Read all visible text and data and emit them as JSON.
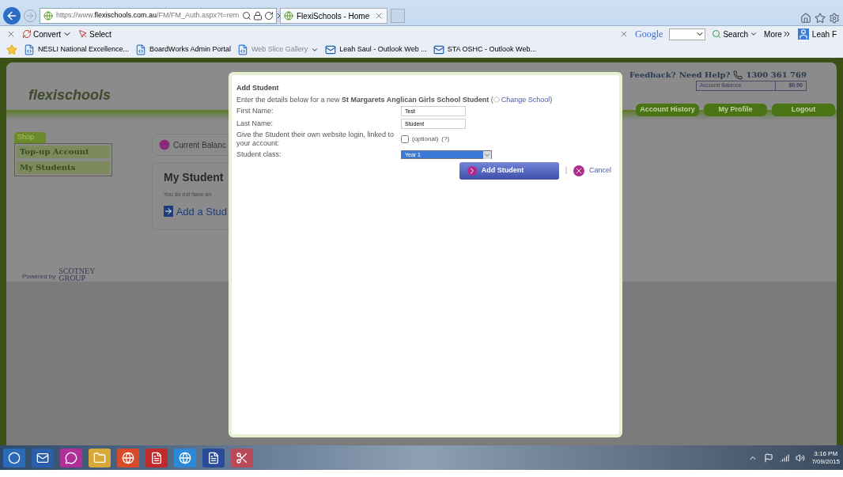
{
  "browser": {
    "address": {
      "prefix": "https://www.",
      "host": "flexischools.com.au",
      "path": "/FM/FM_Auth.aspx?t=rem"
    },
    "tab": {
      "title": "FlexiSchools - Home"
    },
    "toolbar": [
      "Convert",
      "Select"
    ],
    "search": {
      "brand": "Google",
      "button": "Search",
      "more": "More",
      "user": "Leah F"
    },
    "favorites": [
      {
        "label": "NESLI National Excellence...",
        "kind": "page",
        "dim": false
      },
      {
        "label": "BoardWorks Admin Portal",
        "kind": "page",
        "dim": false
      },
      {
        "label": "Web Slice Gallery",
        "kind": "page",
        "dim": true
      },
      {
        "label": "Leah Saul - Outlook Web ...",
        "kind": "outlook",
        "dim": false
      },
      {
        "label": "STA OSHC - Outlook Web...",
        "kind": "outlook",
        "dim": false
      }
    ]
  },
  "page": {
    "logo": "flexischools",
    "help": {
      "feedback": "Feedback?",
      "need_help": "Need Help?",
      "phone": "1300 361 769",
      "balance_label": "Account Balance",
      "balance": "$0.00"
    },
    "nav": [
      "Account History",
      "My Profile",
      "Logout"
    ],
    "sidebar": {
      "tab": "Shop",
      "items": [
        "Top-up Account",
        "My Students"
      ]
    },
    "current_balance": "Current Balanc",
    "students_title": "My Student",
    "students_note": "You do not have an",
    "add_link": "Add a Stud",
    "powered_by": "Powered by",
    "powered_brand": [
      "SCOTNEY",
      "GROUP"
    ]
  },
  "modal": {
    "title": "Add Student",
    "intro": "Enter the details below for a new **St Margarets Anglican Girls School Student** (",
    "change_link": "Change School",
    "intro_end": ")",
    "fields": [
      {
        "label": "First Name:",
        "value": "Test"
      },
      {
        "label": "Last Name:",
        "value": "Student"
      }
    ],
    "login": {
      "label": "Give the Student their own website login, linked to your account:",
      "checked": false,
      "optional": "(optional)",
      "help": "(?)"
    },
    "class": {
      "label": "Student class:",
      "value": "Year 1"
    },
    "submit": "Add Student",
    "separator": "|",
    "cancel": "Cancel"
  },
  "taskbar": {
    "time": "3:16 PM",
    "date": "7/09/2015"
  }
}
